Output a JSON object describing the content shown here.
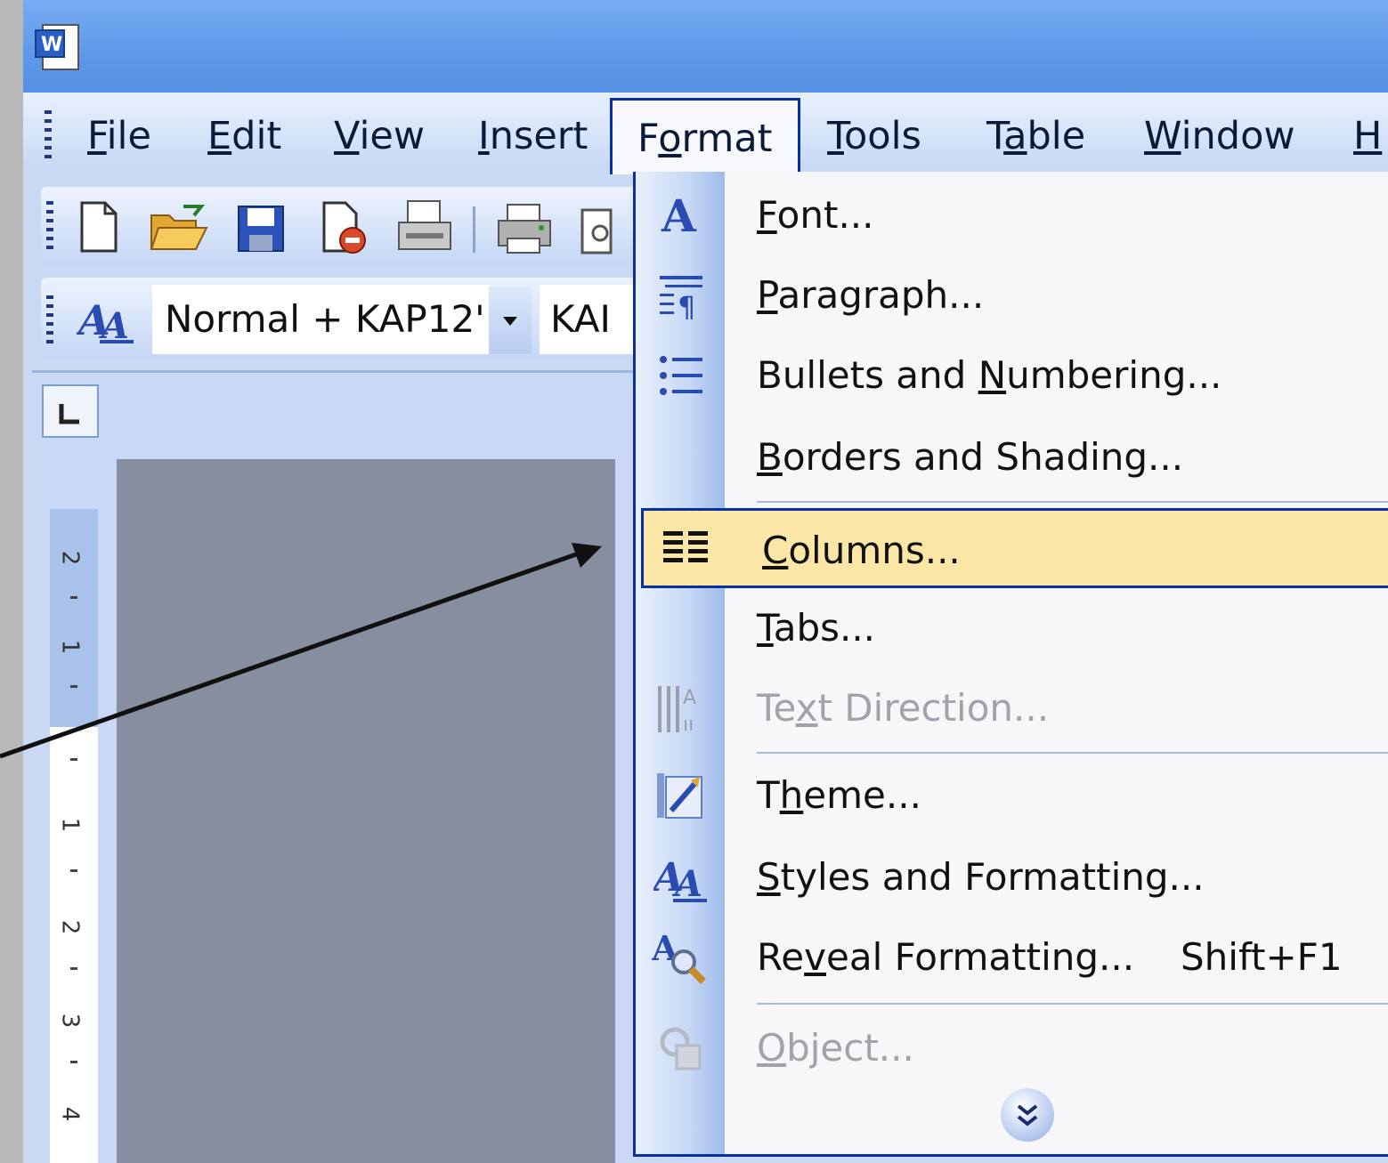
{
  "menubar": {
    "items": [
      {
        "prefix": "",
        "accel": "F",
        "rest": "ile"
      },
      {
        "prefix": "",
        "accel": "E",
        "rest": "dit"
      },
      {
        "prefix": "",
        "accel": "V",
        "rest": "iew"
      },
      {
        "prefix": "",
        "accel": "I",
        "rest": "nsert"
      },
      {
        "prefix": "F",
        "accel": "o",
        "rest": "rmat"
      },
      {
        "prefix": "",
        "accel": "T",
        "rest": "ools"
      },
      {
        "prefix": "T",
        "accel": "a",
        "rest": "ble"
      },
      {
        "prefix": "",
        "accel": "W",
        "rest": "indow"
      },
      {
        "prefix": "",
        "accel": "H",
        "rest": ""
      }
    ]
  },
  "formatting_toolbar": {
    "style_value": "Normal + KAP12'",
    "font_value": "KAI"
  },
  "ruler": {
    "labels": [
      "2",
      "1",
      "1",
      "2",
      "3",
      "4"
    ]
  },
  "format_menu": {
    "items": [
      {
        "prefix": "",
        "accel": "F",
        "rest": "ont...",
        "icon": "font-icon",
        "enabled": true
      },
      {
        "prefix": "",
        "accel": "P",
        "rest": "aragraph...",
        "icon": "paragraph-icon",
        "enabled": true
      },
      {
        "prefix": "Bullets and ",
        "accel": "N",
        "rest": "umbering...",
        "icon": "bullets-icon",
        "enabled": true
      },
      {
        "prefix": "",
        "accel": "B",
        "rest": "orders and Shading...",
        "icon": "",
        "enabled": true
      },
      {
        "prefix": "",
        "accel": "C",
        "rest": "olumns...",
        "icon": "columns-icon",
        "enabled": true,
        "highlighted": true
      },
      {
        "prefix": "",
        "accel": "T",
        "rest": "abs...",
        "icon": "",
        "enabled": true
      },
      {
        "prefix": "Te",
        "accel": "x",
        "rest": "t Direction...",
        "icon": "text-direction-icon",
        "enabled": false
      },
      {
        "prefix": "T",
        "accel": "h",
        "rest": "eme...",
        "icon": "theme-icon",
        "enabled": true
      },
      {
        "prefix": "",
        "accel": "S",
        "rest": "tyles and Formatting...",
        "icon": "styles-icon",
        "enabled": true
      },
      {
        "prefix": "Re",
        "accel": "v",
        "rest": "eal Formatting...",
        "icon": "reveal-formatting-icon",
        "enabled": true,
        "shortcut": "Shift+F1"
      },
      {
        "prefix": "",
        "accel": "O",
        "rest": "bject...",
        "icon": "object-icon",
        "enabled": false
      }
    ]
  },
  "colors": {
    "titlebar": "#5f98ea",
    "highlight": "#fbe6a6",
    "menu_border": "#0a2f9e"
  }
}
